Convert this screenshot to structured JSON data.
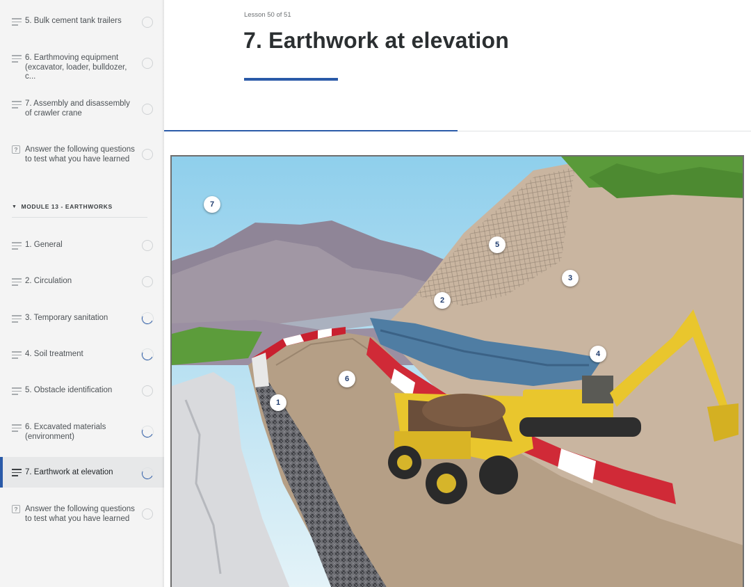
{
  "sidebar": {
    "items_top": [
      {
        "label": "5. Bulk cement tank trailers",
        "type": "lesson",
        "status": "not-started"
      },
      {
        "label": "6. Earthmoving equipment (excavator, loader, bulldozer, c...",
        "type": "lesson",
        "status": "not-started"
      },
      {
        "label": "7. Assembly and disassembly of crawler crane",
        "type": "lesson",
        "status": "not-started"
      },
      {
        "label": "Answer the following questions to test what you have learned",
        "type": "quiz",
        "status": "not-started"
      }
    ],
    "module": {
      "label": "MODULE 13 - EARTHWORKS",
      "items": [
        {
          "label": "1. General",
          "type": "lesson",
          "status": "not-started"
        },
        {
          "label": "2. Circulation",
          "type": "lesson",
          "status": "not-started"
        },
        {
          "label": "3. Temporary sanitation",
          "type": "lesson",
          "status": "in-progress"
        },
        {
          "label": "4. Soil treatment",
          "type": "lesson",
          "status": "in-progress"
        },
        {
          "label": "5. Obstacle identification",
          "type": "lesson",
          "status": "not-started"
        },
        {
          "label": "6. Excavated materials (environment)",
          "type": "lesson",
          "status": "in-progress"
        },
        {
          "label": "7. Earthwork at elevation",
          "type": "lesson",
          "status": "in-progress",
          "active": true
        },
        {
          "label": "Answer the following questions to test what you have learned",
          "type": "quiz",
          "status": "not-started"
        }
      ]
    },
    "quiz_icon_glyph": "?"
  },
  "main": {
    "lesson_counter": "Lesson 50 of 51",
    "title": "7. Earthwork at elevation",
    "lesson_progress": 0.5,
    "accent_color": "#2a5aa8",
    "hotspots": [
      "1",
      "2",
      "3",
      "4",
      "5",
      "6",
      "7"
    ]
  }
}
